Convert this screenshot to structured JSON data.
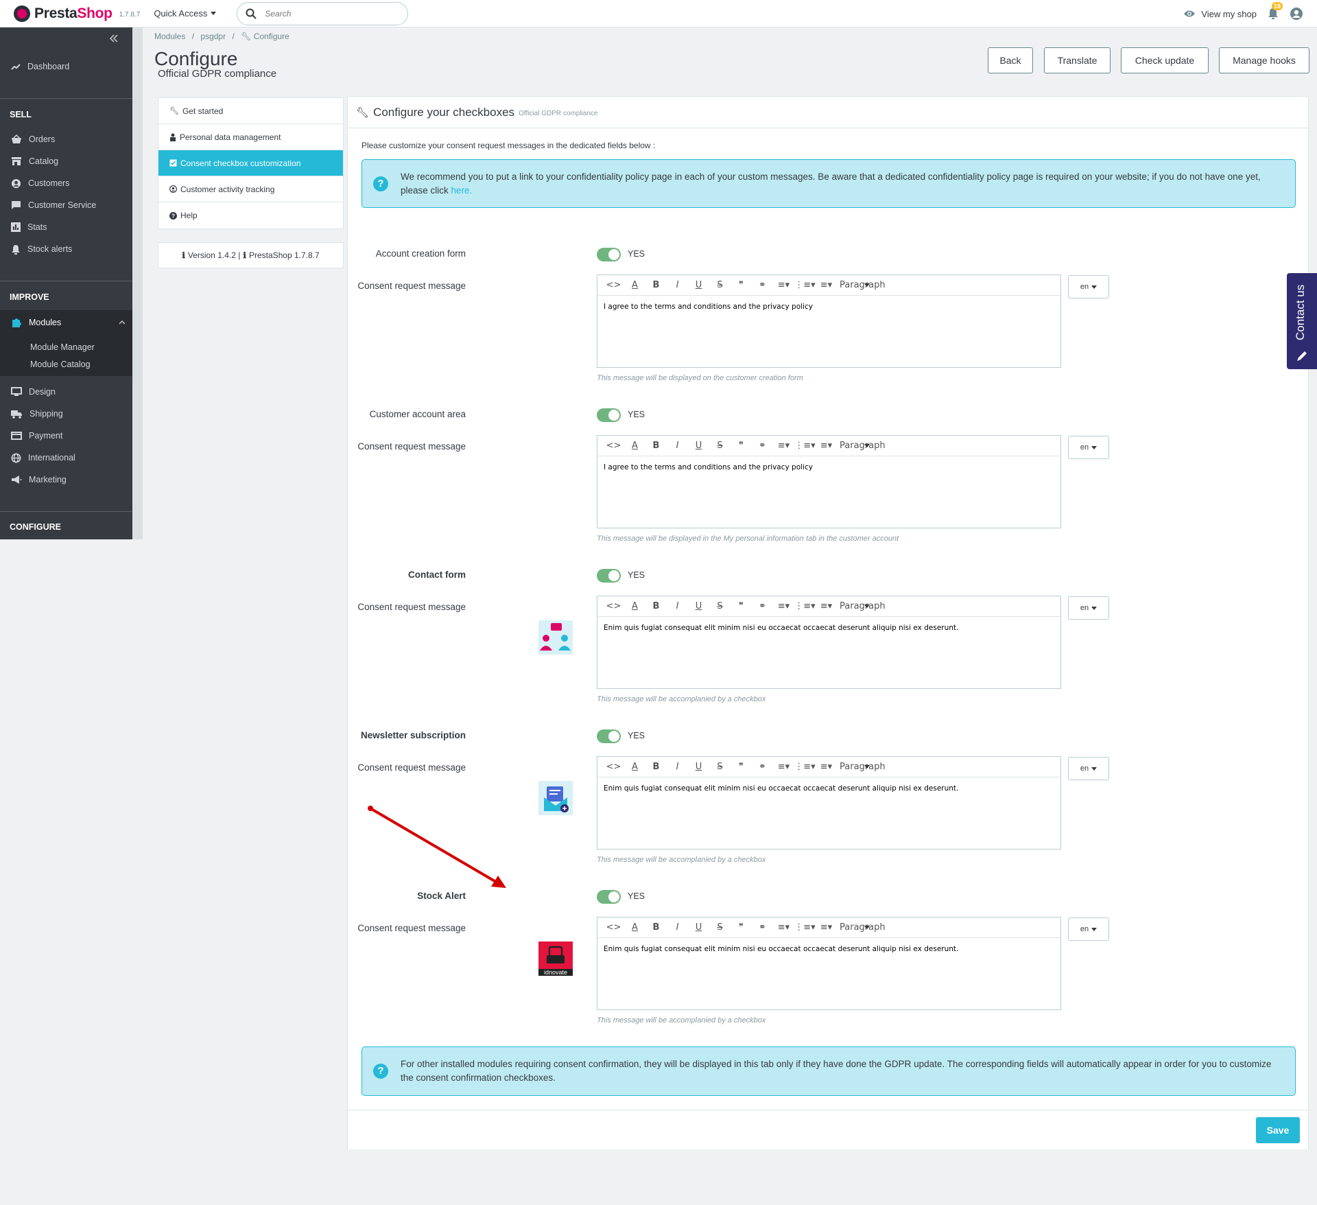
{
  "header": {
    "brand_left": "Presta",
    "brand_right": "Shop",
    "version": "1.7.8.7",
    "quick_access": "Quick Access",
    "search_placeholder": "Search",
    "view_shop": "View my shop",
    "notifications": "18"
  },
  "sidebar": {
    "dashboard": "Dashboard",
    "sell_heading": "SELL",
    "orders": "Orders",
    "catalog": "Catalog",
    "customers": "Customers",
    "customer_service": "Customer Service",
    "stats": "Stats",
    "stock_alerts": "Stock alerts",
    "improve_heading": "IMPROVE",
    "modules": "Modules",
    "module_manager": "Module Manager",
    "module_catalog": "Module Catalog",
    "design": "Design",
    "shipping": "Shipping",
    "payment": "Payment",
    "international": "International",
    "marketing": "Marketing",
    "configure_heading": "CONFIGURE"
  },
  "breadcrumb": [
    "Modules",
    "psgdpr",
    "Configure"
  ],
  "page": {
    "title": "Configure",
    "subtitle": "Official GDPR compliance"
  },
  "toolbar": {
    "back": "Back",
    "translate": "Translate",
    "check_update": "Check update",
    "manage_hooks": "Manage hooks"
  },
  "tabs": [
    "Get started",
    "Personal data management",
    "Consent checkbox customization",
    "Customer activity tracking",
    "Help"
  ],
  "version_box": {
    "module": "Version 1.4.2 |",
    "prestashop": "PrestaShop 1.7.8.7"
  },
  "panel": {
    "title": "Configure your checkboxes",
    "subtitle": "Official GDPR compliance",
    "intro": "Please customize your consent request messages in the dedicated fields below :",
    "alert_top_text": "We recommend you to put a link to your confidentiality policy page in each of your custom messages. Be aware that a dedicated confidentiality policy page is required on your website; if you do not have one yet, please click",
    "alert_top_link": "here.",
    "alert_bottom": "For other installed modules requiring consent confirmation, they will be displayed in this tab only if they have done the GDPR update. The corresponding fields will automatically appear in order for you to customize the consent confirmation checkboxes.",
    "save": "Save"
  },
  "editor_toolbar": {
    "paragraph": "Paragraph"
  },
  "sections": [
    {
      "label": "Account creation form",
      "toggle": "YES",
      "message_label": "Consent request message",
      "message": "I agree to the terms and conditions and the privacy policy",
      "lang": "en",
      "help": "This message will be displayed on the customer creation form"
    },
    {
      "label": "Customer account area",
      "toggle": "YES",
      "message_label": "Consent request message",
      "message": "I agree to the terms and conditions and the privacy policy",
      "lang": "en",
      "help": "This message will be displayed in the My personal information tab in the customer account"
    },
    {
      "label": "Contact form",
      "toggle": "YES",
      "message_label": "Consent request message",
      "message": "Enim quis fugiat consequat elit minim nisi eu occaecat occaecat deserunt aliquip nisi ex deserunt.",
      "lang": "en",
      "help": "This message will be accomplanied by a checkbox"
    },
    {
      "label": "Newsletter subscription",
      "toggle": "YES",
      "message_label": "Consent request message",
      "message": "Enim quis fugiat consequat elit minim nisi eu occaecat occaecat deserunt aliquip nisi ex deserunt.",
      "lang": "en",
      "help": "This message will be accomplanied by a checkbox"
    },
    {
      "label": "Stock Alert",
      "toggle": "YES",
      "message_label": "Consent request message",
      "message": "Enim quis fugiat consequat elit minim nisi eu occaecat occaecat deserunt aliquip nisi ex deserunt.",
      "lang": "en",
      "help": "This message will be accomplanied by a checkbox",
      "logo_text": "idnovate"
    }
  ],
  "contact_us": "Contact us",
  "colors": {
    "primary": "#25b9d7",
    "sidebar": "#363a41",
    "toggle_on": "#70b580",
    "brand": "#df0067"
  }
}
